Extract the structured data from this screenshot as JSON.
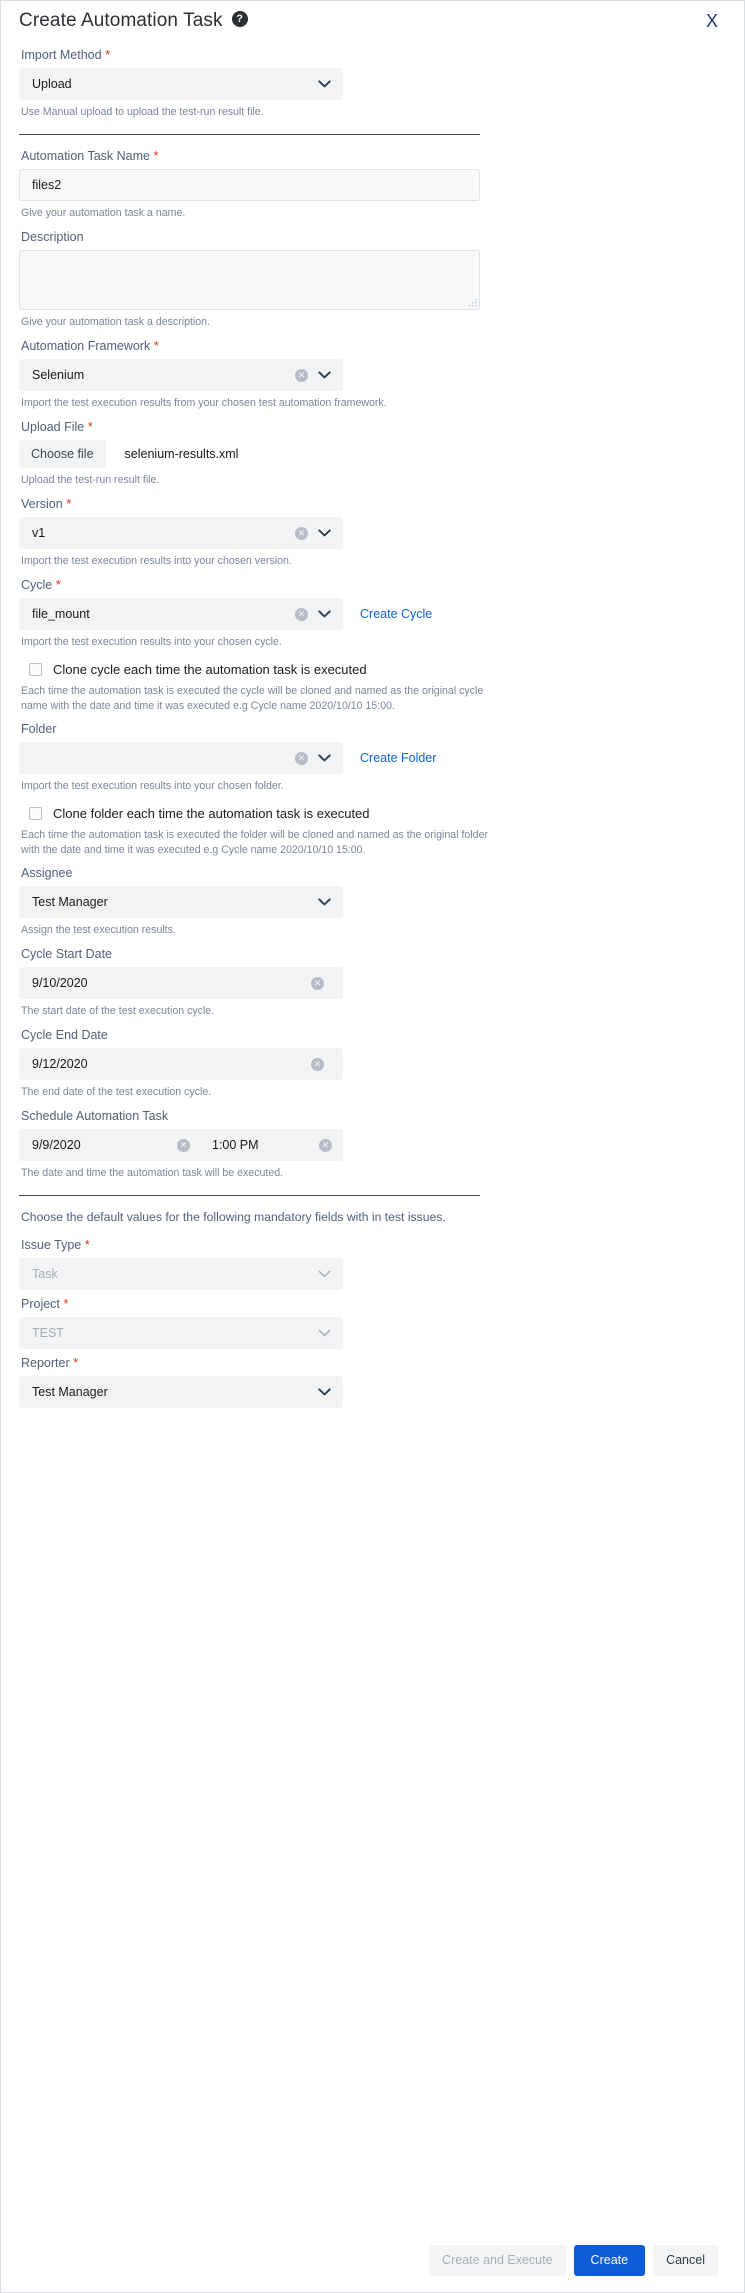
{
  "dialog": {
    "title": "Create Automation Task",
    "help_icon": "help-circle-icon",
    "close_label": "X"
  },
  "fields": {
    "import_method": {
      "label": "Import Method",
      "required": "*",
      "value": "Upload",
      "hint": "Use Manual upload to upload the test-run result file."
    },
    "task_name": {
      "label": "Automation Task Name",
      "required": "*",
      "value": "files2",
      "hint": "Give your automation task a name."
    },
    "description": {
      "label": "Description",
      "value": "",
      "placeholder": "",
      "hint": "Give your automation task a description."
    },
    "framework": {
      "label": "Automation Framework",
      "required": "*",
      "value": "Selenium",
      "hint": "Import the test execution results from your chosen test automation framework."
    },
    "upload_file": {
      "label": "Upload File",
      "required": "*",
      "button_label": "Choose file",
      "file_name": "selenium-results.xml",
      "hint": "Upload the test-run result file."
    },
    "version": {
      "label": "Version",
      "required": "*",
      "value": "v1",
      "hint": "Import the test execution results into your chosen version."
    },
    "cycle": {
      "label": "Cycle",
      "required": "*",
      "value": "file_mount",
      "link": "Create Cycle",
      "hint": "Import the test execution results into your chosen cycle.",
      "clone_label": "Clone cycle each time the automation task is executed",
      "clone_note": "Each time the automation task is executed the cycle will be cloned and named as the original cycle name with the date and time it was executed e.g Cycle name 2020/10/10 15:00."
    },
    "folder": {
      "label": "Folder",
      "value": "",
      "link": "Create Folder",
      "hint": "Import the test execution results into your chosen folder.",
      "clone_label": "Clone folder each time the automation task is executed",
      "clone_note": "Each time the automation task is executed the folder will be cloned and named as the original folder with the date and time it was executed e.g Cycle name 2020/10/10 15:00."
    },
    "assignee": {
      "label": "Assignee",
      "value": "Test Manager",
      "hint": "Assign the test execution results."
    },
    "cycle_start_date": {
      "label": "Cycle Start Date",
      "value": "9/10/2020",
      "hint": "The start date of the test execution cycle."
    },
    "cycle_end_date": {
      "label": "Cycle End Date",
      "value": "9/12/2020",
      "hint": "The end date of the test execution cycle."
    },
    "schedule": {
      "label": "Schedule Automation Task",
      "date_value": "9/9/2020",
      "time_value": "1:00 PM",
      "hint": "The date and time the automation task will be executed."
    },
    "defaults_note": "Choose the default values for the following mandatory fields with in test issues.",
    "issue_type": {
      "label": "Issue Type",
      "required": "*",
      "value": "Task"
    },
    "project": {
      "label": "Project",
      "required": "*",
      "value": "TEST"
    },
    "reporter": {
      "label": "Reporter",
      "required": "*",
      "value": "Test Manager"
    }
  },
  "footer": {
    "create_and_execute": "Create and Execute",
    "create": "Create",
    "cancel": "Cancel"
  },
  "colors": {
    "primary": "#0b5cd5",
    "link": "#0b62d1",
    "required": "#de350b",
    "label": "#51607a",
    "hint": "#7a8699",
    "control_bg": "#f2f3f5"
  }
}
